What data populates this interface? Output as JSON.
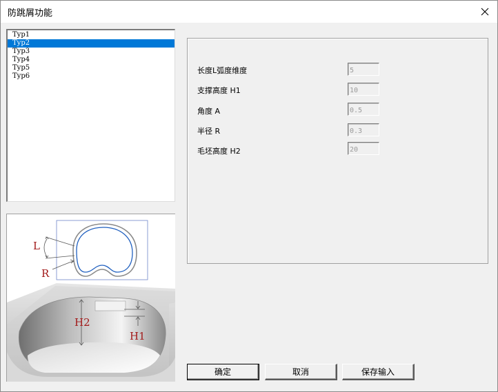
{
  "window": {
    "title": "防跳屑功能",
    "close_glyph": "✕"
  },
  "type_list": {
    "items": [
      "Typ1",
      "Typ2",
      "Typ3",
      "Typ4",
      "Typ5",
      "Typ6"
    ],
    "selected_index": 1
  },
  "illustration": {
    "labels": {
      "L": "L",
      "R": "R",
      "H2": "H2",
      "H1": "H1"
    },
    "label_color": "#a11818",
    "accent_color": "#1f5fbf"
  },
  "params": [
    {
      "label": "长度L弧度维度",
      "value": "5"
    },
    {
      "label": "支撑高度 H1",
      "value": "10"
    },
    {
      "label": "角度 A",
      "value": "0.5"
    },
    {
      "label": "半径 R",
      "value": "0.3"
    },
    {
      "label": "毛坯高度 H2",
      "value": "20"
    }
  ],
  "buttons": {
    "ok": "确定",
    "cancel": "取消",
    "save_input": "保存输入"
  }
}
